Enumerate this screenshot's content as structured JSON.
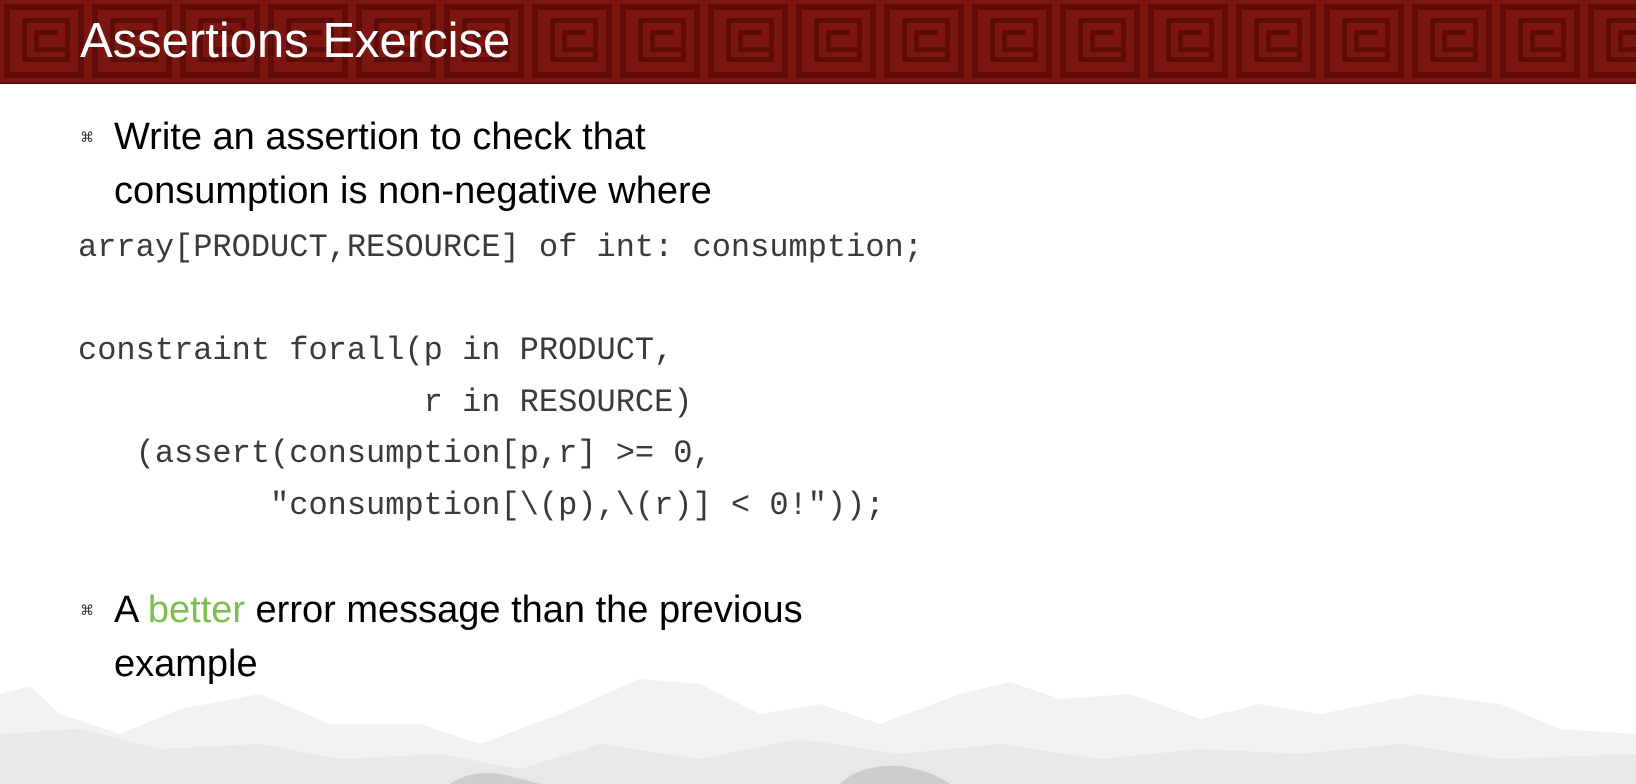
{
  "slide": {
    "title": "Assertions Exercise",
    "bullet_icon": "command-key-bullet",
    "bullets": [
      {
        "lines": [
          "Write an assertion to check that",
          "consumption is non-negative where"
        ]
      },
      {
        "prefix": "A ",
        "highlight": "better",
        "suffix": " error message than the previous",
        "line2": "example"
      }
    ],
    "code_lines": [
      "array[PRODUCT,RESOURCE] of int: consumption;",
      "",
      "constraint forall(p in PRODUCT,",
      "                  r in RESOURCE)",
      "   (assert(consumption[p,r] >= 0,",
      "          \"consumption[\\(p),\\(r)] < 0!\"));"
    ],
    "colors": {
      "header": "#7d1611",
      "highlight": "#7bbf4f"
    }
  }
}
